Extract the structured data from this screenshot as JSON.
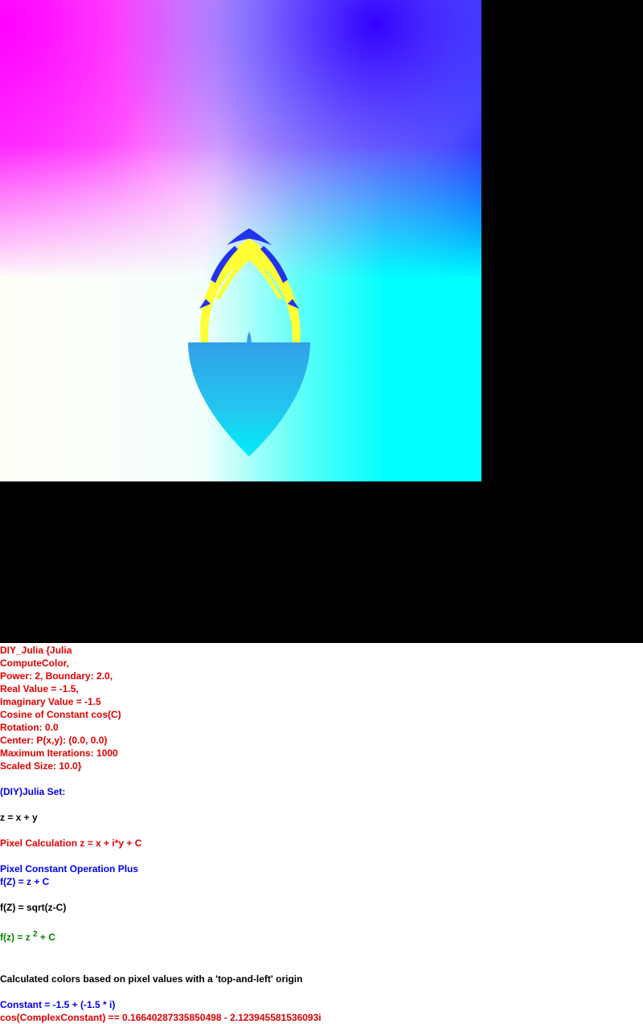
{
  "canvas": {
    "background_color": "#000000",
    "gradient_colors": [
      "#ff00ff",
      "#0000ff",
      "#ffffff",
      "#00ffff"
    ],
    "fractal_colors": [
      "#ffff33",
      "#2233ee",
      "#33a0e8",
      "#00e8f8"
    ]
  },
  "info": {
    "params": {
      "line1": "DIY_Julia {Julia",
      "line2": "ComputeColor,",
      "line3": "Power: 2, Boundary: 2.0,",
      "line4": "Real Value = -1.5,",
      "line5": "Imaginary Value = -1.5",
      "line6": "Cosine of Constant cos(C)",
      "line7": "Rotation: 0.0",
      "line8": "Center: P(x,y): (0.0, 0.0)",
      "line9": "Maximum Iterations: 1000",
      "line10": "Scaled Size: 10.0}"
    },
    "set_title": "(DIY)Julia Set:",
    "z_def": "z = x + y",
    "pixel_calc": "Pixel Calculation z = x + i*y + C",
    "constant_op": "Pixel Constant Operation Plus",
    "f_plus": "f(Z) = z + C",
    "f_sqrt": "f(Z) = sqrt(z-C)",
    "f_power": {
      "prefix": "f(z) = z ",
      "exponent": "2",
      "suffix": " + C"
    },
    "origin_note": "Calculated colors based on pixel values with a 'top-and-left' origin",
    "constant": "Constant = -1.5 + (-1.5 * i)",
    "cos_constant": "cos(ComplexConstant) == 0.16640287335850498 - 2.123945581536093i"
  }
}
